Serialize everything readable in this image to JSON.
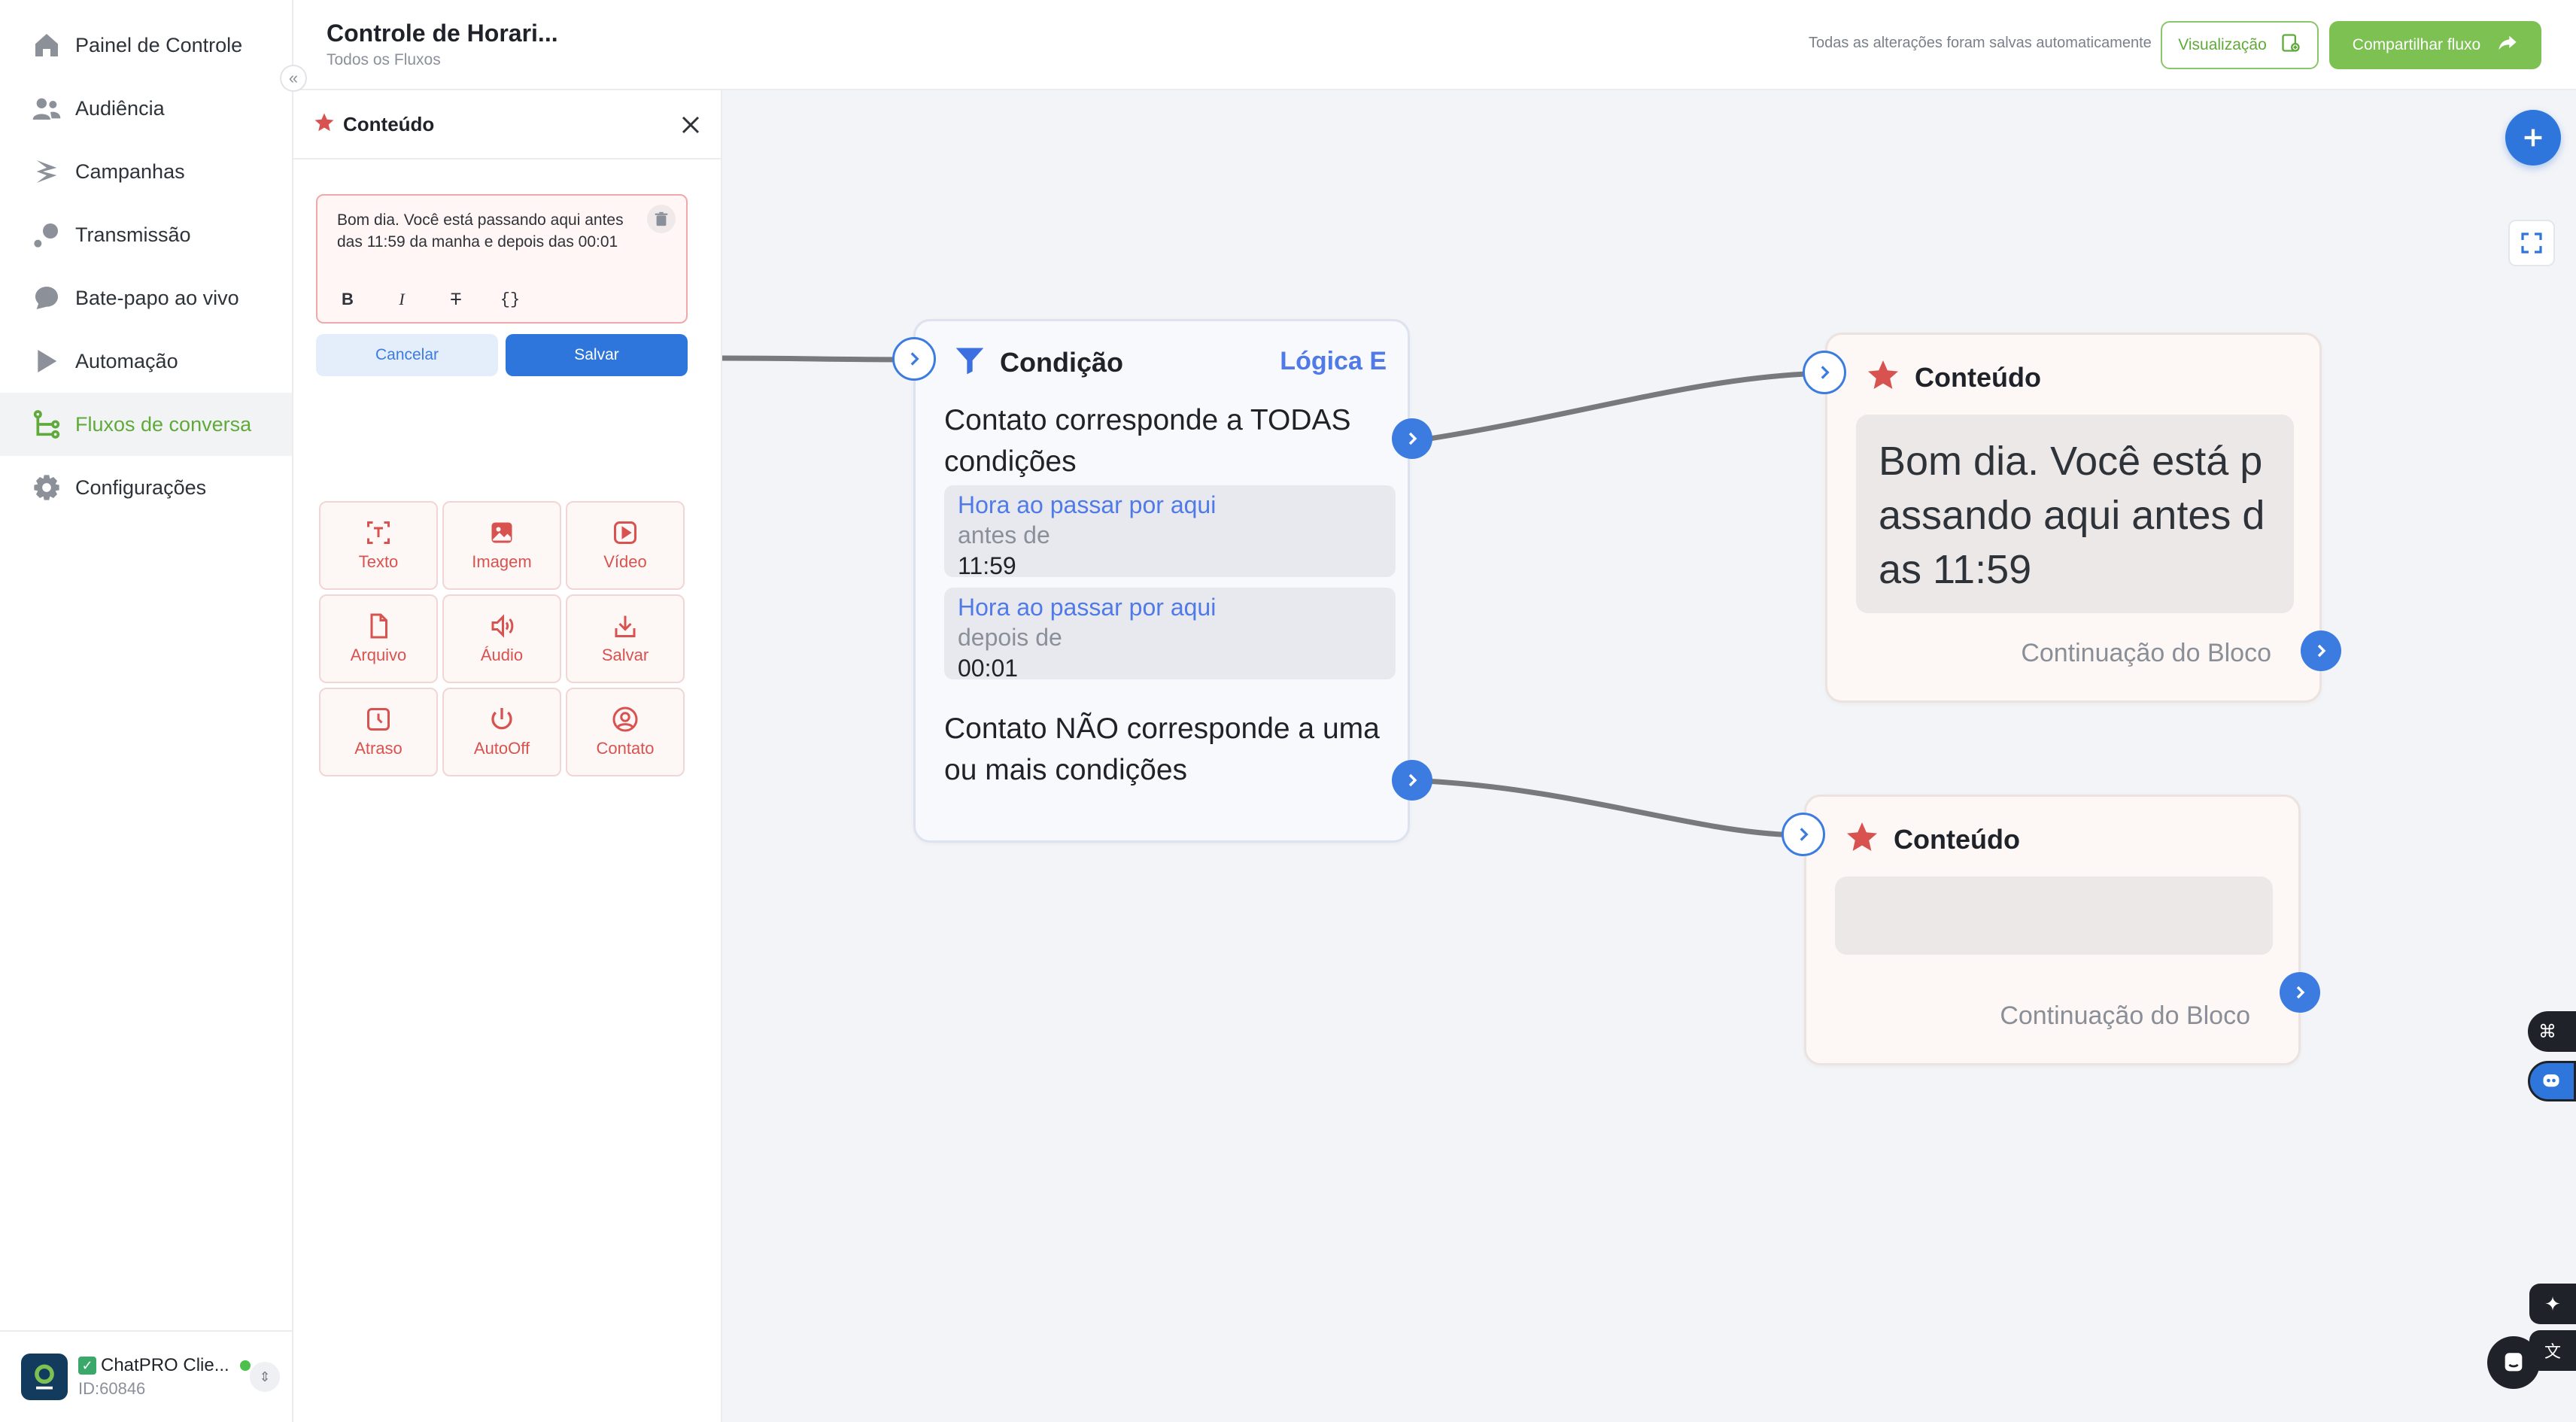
{
  "app": {
    "brand_color": "#5faa3a",
    "accent": "#2f76dc",
    "danger": "#d8534f"
  },
  "sidebar": {
    "items": [
      {
        "label": "Painel de Controle",
        "icon": "home-icon"
      },
      {
        "label": "Audiência",
        "icon": "people-icon"
      },
      {
        "label": "Campanhas",
        "icon": "campaign-icon"
      },
      {
        "label": "Transmissão",
        "icon": "broadcast-icon"
      },
      {
        "label": "Bate-papo ao vivo",
        "icon": "chat-bubble-icon"
      },
      {
        "label": "Automação",
        "icon": "play-icon"
      },
      {
        "label": "Fluxos de conversa",
        "icon": "flow-icon",
        "active": true
      },
      {
        "label": "Configurações",
        "icon": "gear-icon"
      }
    ],
    "account": {
      "name": "ChatPRO Clie...",
      "id": "ID:60846"
    }
  },
  "header": {
    "title": "Controle de Horari...",
    "subtitle": "Todos os Fluxos",
    "saved_status": "Todas as alterações foram salvas automaticamente",
    "preview_label": "Visualização",
    "share_label": "Compartilhar fluxo"
  },
  "panel": {
    "title": "Conteúdo",
    "editor_text": "Bom dia. Você está passando aqui antes das 11:59 da manha e depois das 00:01",
    "cancel_label": "Cancelar",
    "save_label": "Salvar",
    "tiles": [
      {
        "label": "Texto",
        "icon": "text-icon"
      },
      {
        "label": "Imagem",
        "icon": "image-icon"
      },
      {
        "label": "Vídeo",
        "icon": "video-icon"
      },
      {
        "label": "Arquivo",
        "icon": "file-icon"
      },
      {
        "label": "Áudio",
        "icon": "audio-icon"
      },
      {
        "label": "Salvar",
        "icon": "download-icon"
      },
      {
        "label": "Atraso",
        "icon": "clock-icon"
      },
      {
        "label": "AutoOff",
        "icon": "power-icon"
      },
      {
        "label": "Contato",
        "icon": "contact-icon"
      }
    ]
  },
  "canvas": {
    "condition": {
      "title": "Condição",
      "logic": "Lógica E",
      "match_text": "Contato corresponde a TODAS condições",
      "rules": [
        {
          "field": "Hora ao passar por aqui",
          "operator": "antes de",
          "value": "11:59"
        },
        {
          "field": "Hora ao passar por aqui",
          "operator": "depois de",
          "value": "00:01"
        }
      ],
      "nomatch_text": "Contato NÃO corresponde a uma ou mais condições"
    },
    "content_nodes": [
      {
        "title": "Conteúdo",
        "message": "Bom dia. Você está passando aqui antes das 11:59",
        "continuation": "Continuação do Bloco"
      },
      {
        "title": "Conteúdo",
        "message": "",
        "continuation": "Continuação do Bloco"
      }
    ]
  }
}
